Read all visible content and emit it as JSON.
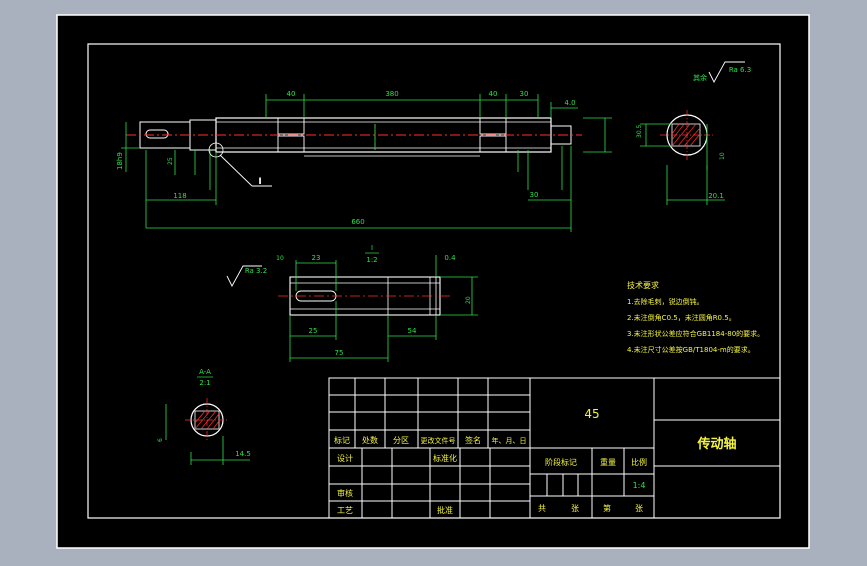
{
  "drawing": {
    "material": "45",
    "part_name": "传动轴",
    "scale_value": "1:4",
    "title_block": {
      "row_labels": [
        "标记",
        "处数",
        "分区",
        "更改文件号",
        "签名",
        "年、月、日"
      ],
      "design": "设计",
      "standardize": "标准化",
      "stage_mark": "阶段标记",
      "weight": "重量",
      "scale": "比例",
      "review": "审核",
      "process": "工艺",
      "approve": "批准",
      "total": "共",
      "sheet1": "张",
      "nth": "第",
      "sheet2": "张"
    },
    "tech_requirements": {
      "title": "技术要求",
      "items": [
        "1.去除毛刺，锐边倒钝。",
        "2.未注倒角C0.5，未注圆角R0.5。",
        "3.未注形状公差应符合GB1184-80的要求。",
        "4.未注尺寸公差按GB/T1804-m的要求。"
      ]
    },
    "main_view": {
      "dim_top": [
        "40",
        "380",
        "40",
        "30"
      ],
      "dim_top_right": "4.0",
      "dim_118": "118",
      "dim_30": "30",
      "dim_total": "660",
      "detail_callout": "I",
      "dim_left_vert": "18h9",
      "dim_small": "25"
    },
    "section_b": {
      "roughness_label": "其余",
      "roughness_value": "Ra 6.3",
      "dim_left": "30.5",
      "dim_right": "10",
      "dim_bottom": "20.1"
    },
    "detail_view": {
      "label": "I",
      "scale": "1:2",
      "roughness": "Ra 3.2",
      "dim_23": "23",
      "dim_04": "0.4",
      "dim_25": "25",
      "dim_10": "10",
      "dim_54": "54",
      "dim_75": "75",
      "dim_right": "20"
    },
    "section_a": {
      "label": "A-A",
      "scale": "2:1",
      "dim_left": "6",
      "dim_bottom": "14.5"
    }
  }
}
